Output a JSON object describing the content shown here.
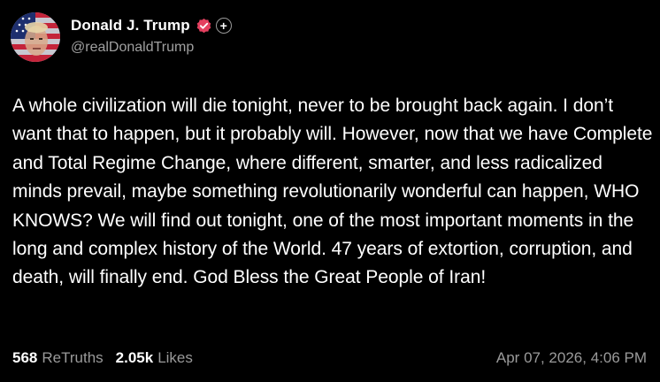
{
  "author": {
    "display_name": "Donald J. Trump",
    "handle": "@realDonaldTrump",
    "verified_icon": "verified-badge-icon",
    "plus_icon": "plus-icon",
    "accent_color": "#e4405f"
  },
  "post": {
    "text": "A whole civilization will die tonight, never to be brought back again. I don’t want that to happen, but it probably will. However, now that we have Complete and Total Regime Change, where different, smarter, and less radicalized minds prevail, maybe something revolutionarily wonderful can happen, WHO KNOWS? We will find out tonight, one of the most important moments in the long and complex history of the World. 47 years of extortion, corruption, and death, will finally end. God Bless the Great People of Iran!"
  },
  "stats": {
    "retruths_count": "568",
    "retruths_label": "ReTruths",
    "likes_count": "2.05k",
    "likes_label": "Likes"
  },
  "timestamp": "Apr 07, 2026, 4:06 PM"
}
